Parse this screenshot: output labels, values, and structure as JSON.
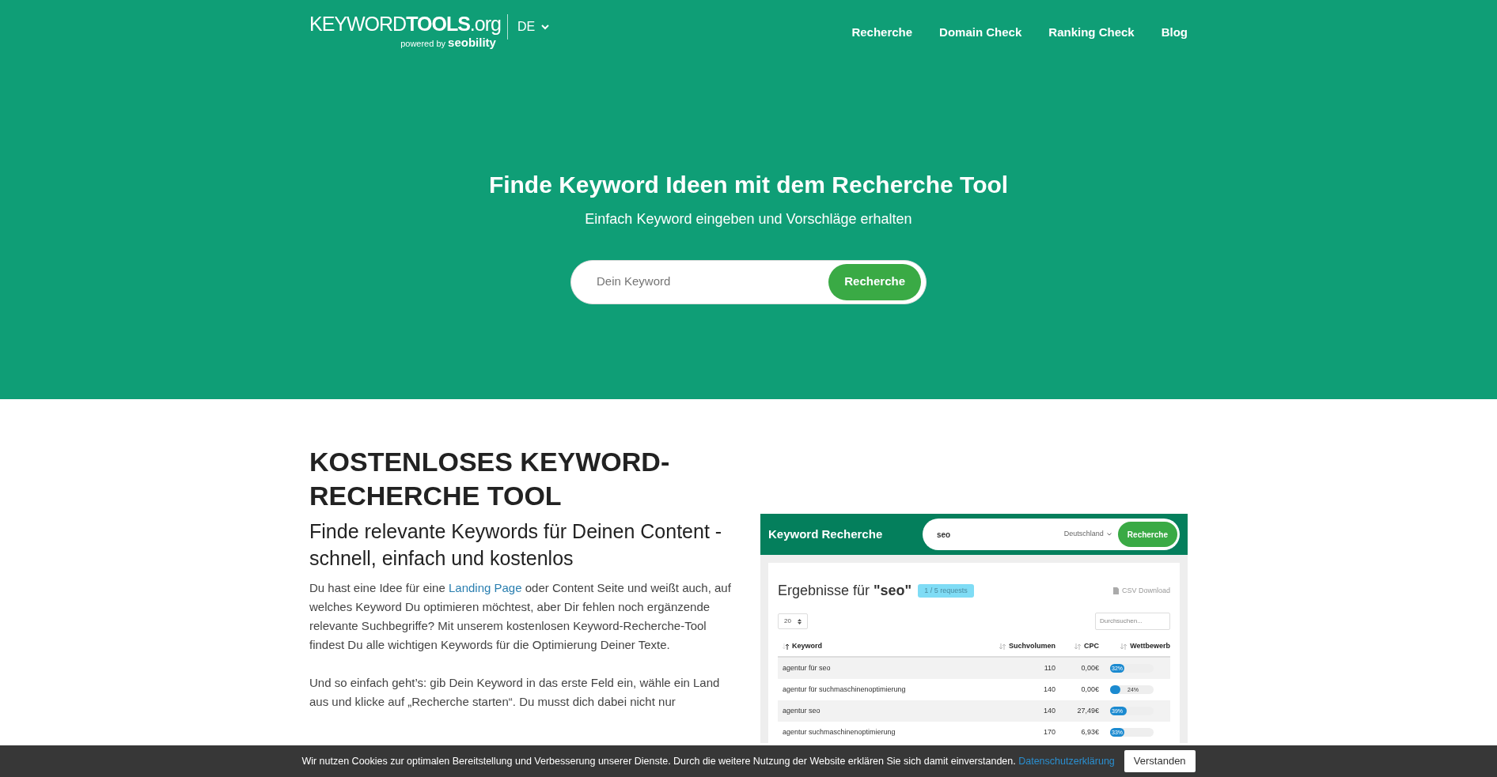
{
  "header": {
    "logo": "KEYWORD**TOOLS**.org",
    "powered_by": "powered by **seobility**",
    "language": "DE",
    "nav": [
      {
        "label": "Recherche"
      },
      {
        "label": "Domain Check"
      },
      {
        "label": "Ranking Check"
      },
      {
        "label": "Blog"
      }
    ]
  },
  "hero": {
    "title": "Finde Keyword Ideen mit dem Recherche Tool",
    "subtitle": "Einfach Keyword eingeben und Vorschläge erhalten",
    "search": {
      "placeholder": "Dein Keyword",
      "button": "Recherche"
    }
  },
  "content": {
    "heading": "KOSTENLOSES KEYWORD-RECHERCHE TOOL",
    "subheading": "Finde relevante Keywords für Deinen Content - schnell, einfach und kostenlos",
    "paragraphs": [
      [
        {
          "kind": "text",
          "text": "Du hast eine Idee für eine "
        },
        {
          "kind": "link",
          "text": "Landing Page"
        },
        {
          "kind": "text",
          "text": " oder Content Seite und weißt auch, auf welches Keyword Du optimieren möchtest, aber Dir fehlen noch ergänzende relevante Suchbegriffe? Mit unserem kostenlosen Keyword-Recherche-Tool findest Du alle wichtigen Keywords für die Optimierung Deiner Texte."
        }
      ],
      [
        {
          "kind": "text",
          "text": "Und so einfach geht’s: gib Dein Keyword in das erste Feld ein, wähle ein Land aus und klicke auf „Recherche starten“. Du musst dich dabei nicht nur"
        }
      ]
    ]
  },
  "preview": {
    "title": "Keyword Recherche",
    "search_value": "seo",
    "country": "Deutschland",
    "button": "Recherche",
    "results_title": "Ergebnisse für **\"seo\"**",
    "badge": "1 / 5 requests",
    "csv": "CSV Download",
    "page_size": "20",
    "filter_placeholder": "Durchsuchen...",
    "columns": [
      {
        "label": "Keyword",
        "sorted": true
      },
      {
        "label": "Suchvolumen",
        "sorted": false
      },
      {
        "label": "CPC",
        "sorted": false
      },
      {
        "label": "Wettbewerb",
        "sorted": false
      }
    ],
    "rows": [
      {
        "keyword": "agentur für seo",
        "volume": "110",
        "cpc": "0,00€",
        "level": 0.32,
        "reading": "32%"
      },
      {
        "keyword": "agentur für suchmaschinenoptimierung",
        "volume": "140",
        "cpc": "0,00€",
        "level": 0.24,
        "reading": "24%"
      },
      {
        "keyword": "agentur seo",
        "volume": "140",
        "cpc": "27,49€",
        "level": 0.39,
        "reading": "39%"
      },
      {
        "keyword": "agentur suchmaschinenoptimierung",
        "volume": "170",
        "cpc": "6,93€",
        "level": 0.33,
        "reading": "33%"
      }
    ]
  },
  "cookie": {
    "text": "Wir nutzen Cookies zur optimalen Bereitstellung und Verbesserung unserer Dienste. Durch die weitere Nutzung der Website erklären Sie sich damit einverstanden.",
    "link": "Datenschutzerklärung",
    "button": "Verstanden"
  }
}
